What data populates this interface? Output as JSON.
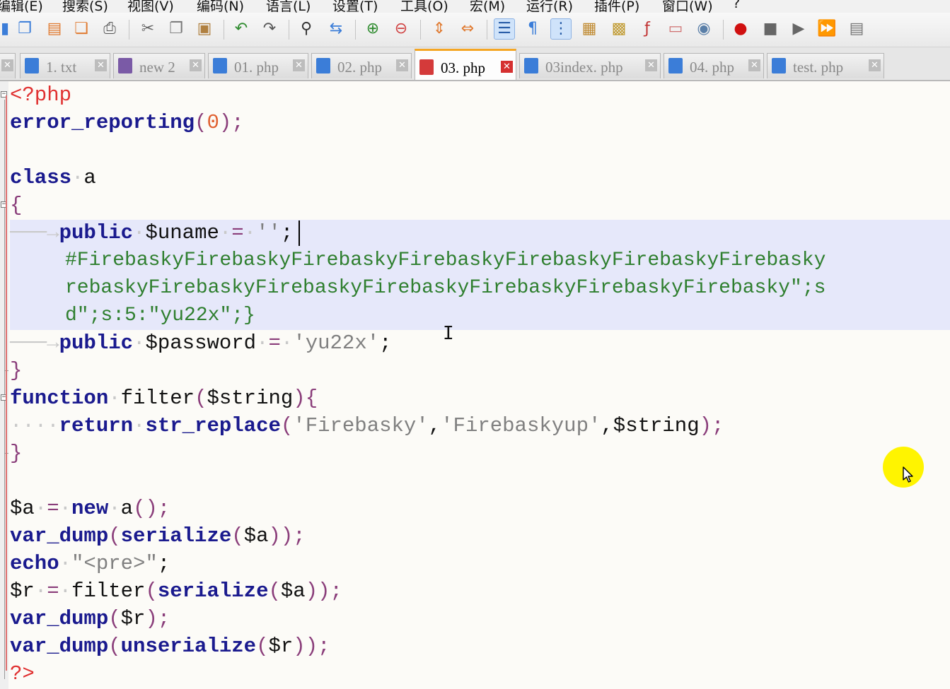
{
  "menubar": {
    "items": [
      "编辑(E)",
      "搜索(S)",
      "视图(V)",
      "编码(N)",
      "语言(L)",
      "设置(T)",
      "工具(O)",
      "宏(M)",
      "运行(R)",
      "插件(P)",
      "窗口(W)",
      "?"
    ]
  },
  "toolbar": {
    "icons": [
      "save-all-icon",
      "close-icon",
      "close-all-icon",
      "print-icon",
      "cut-icon",
      "copy-icon",
      "paste-icon",
      "undo-icon",
      "redo-icon",
      "find-icon",
      "replace-icon",
      "zoom-in-icon",
      "zoom-out-icon",
      "sync-vertical-icon",
      "sync-horizontal-icon",
      "word-wrap-icon",
      "show-all-chars-icon",
      "indent-guide-icon",
      "udl-icon",
      "doc-map-icon",
      "function-list-icon",
      "folder-workspace-icon",
      "monitoring-icon",
      "record-macro-icon",
      "stop-macro-icon",
      "play-macro-icon",
      "run-macro-multiple-icon",
      "save-macro-icon"
    ]
  },
  "tabs": [
    {
      "label": "",
      "active": false,
      "color": "#5a8fd6"
    },
    {
      "label": "1. txt",
      "active": false,
      "color": "#3b7dd8"
    },
    {
      "label": "new  2",
      "active": false,
      "color": "#7a5aa6"
    },
    {
      "label": "01. php",
      "active": false,
      "color": "#3b7dd8"
    },
    {
      "label": "02. php",
      "active": false,
      "color": "#3b7dd8"
    },
    {
      "label": "03. php",
      "active": true,
      "color": "#d43a3a"
    },
    {
      "label": "03index. php",
      "active": false,
      "color": "#3b7dd8"
    },
    {
      "label": "04. php",
      "active": false,
      "color": "#3b7dd8"
    },
    {
      "label": "test. php",
      "active": false,
      "color": "#3b7dd8"
    }
  ],
  "code": {
    "l1": "<?php",
    "l2_fn": "error_reporting",
    "l2_open": "(",
    "l2_num": "0",
    "l2_close": ");",
    "l4_kw": "class",
    "l4_name": "a",
    "l5": "{",
    "l6_kw": "public",
    "l6_var": "$uname",
    "l6_eq": "=",
    "l6_str": "''",
    "l6_end": ";",
    "l7": "#FirebaskyFirebaskyFirebaskyFirebaskyFirebaskyFirebaskyFirebasky",
    "l8": "rebaskyFirebaskyFirebaskyFirebaskyFirebaskyFirebaskyFirebasky\";s",
    "l9": "d\";s:5:\"yu22x\";}",
    "l10_kw": "public",
    "l10_var": "$password",
    "l10_eq": "=",
    "l10_str": "'yu22x'",
    "l10_end": ";",
    "l11": "}",
    "l12_kw": "function",
    "l12_name": "filter",
    "l12_open": "(",
    "l12_arg": "$string",
    "l12_close": "){",
    "l13_kw": "return",
    "l13_fn": "str_replace",
    "l13_open": "(",
    "l13_s1": "'Firebasky'",
    "l13_comma1": ",",
    "l13_s2": "'Firebaskyup'",
    "l13_comma2": ",",
    "l13_arg": "$string",
    "l13_close": ");",
    "l14": "}",
    "l16_var": "$a",
    "l16_eq": "=",
    "l16_kw": "new",
    "l16_rest": "a",
    "l16_par": "();",
    "l17_fn": "var_dump",
    "l17_o1": "(",
    "l17_fn2": "serialize",
    "l17_o2": "(",
    "l17_arg": "$a",
    "l17_close": "));",
    "l18_kw": "echo",
    "l18_str": "\"<pre>\"",
    "l18_end": ";",
    "l19_var": "$r",
    "l19_eq": "=",
    "l19_fn": "filter",
    "l19_o1": "(",
    "l19_fn2": "serialize",
    "l19_o2": "(",
    "l19_arg": "$a",
    "l19_close": "));",
    "l20_fn": "var_dump",
    "l20_o": "(",
    "l20_arg": "$r",
    "l20_close": ");",
    "l21_fn": "var_dump",
    "l21_o1": "(",
    "l21_fn2": "unserialize",
    "l21_o2": "(",
    "l21_arg": "$r",
    "l21_close": "));",
    "l22": "?>"
  },
  "colors": {
    "keyword": "#1a1a8e",
    "php_tag": "#e03030",
    "string": "#808080",
    "comment": "#2f7f2f",
    "line_highlight": "#e6e8fa",
    "mouse_highlight": "#fff400"
  }
}
